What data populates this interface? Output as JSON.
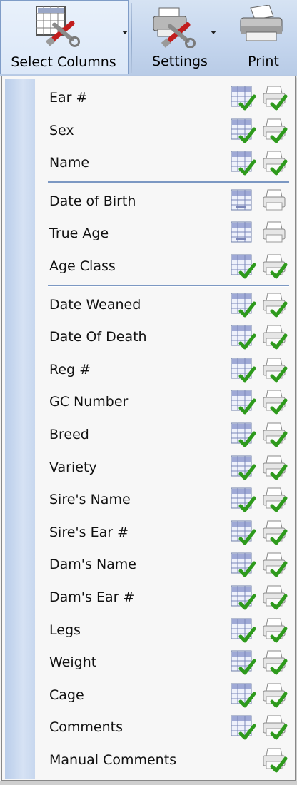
{
  "toolbar": {
    "select_columns_label": "Select Columns",
    "settings_label": "Settings",
    "print_label": "Print"
  },
  "menu": {
    "groups": [
      {
        "items": [
          {
            "label": "Ear #",
            "grid": "checked",
            "print": "checked"
          },
          {
            "label": "Sex",
            "grid": "checked",
            "print": "checked"
          },
          {
            "label": "Name",
            "grid": "checked",
            "print": "checked"
          }
        ]
      },
      {
        "items": [
          {
            "label": "Date of Birth",
            "grid": "hidden",
            "print": "unchecked"
          },
          {
            "label": "True Age",
            "grid": "hidden",
            "print": "unchecked"
          },
          {
            "label": "Age Class",
            "grid": "checked",
            "print": "checked"
          }
        ]
      },
      {
        "items": [
          {
            "label": "Date Weaned",
            "grid": "checked",
            "print": "checked"
          },
          {
            "label": "Date Of Death",
            "grid": "checked",
            "print": "checked"
          },
          {
            "label": "Reg #",
            "grid": "checked",
            "print": "checked"
          },
          {
            "label": "GC Number",
            "grid": "checked",
            "print": "checked"
          },
          {
            "label": "Breed",
            "grid": "checked",
            "print": "checked"
          },
          {
            "label": "Variety",
            "grid": "checked",
            "print": "checked"
          },
          {
            "label": "Sire's Name",
            "grid": "checked",
            "print": "checked"
          },
          {
            "label": "Sire's Ear #",
            "grid": "checked",
            "print": "checked"
          },
          {
            "label": "Dam's Name",
            "grid": "checked",
            "print": "checked"
          },
          {
            "label": "Dam's Ear #",
            "grid": "checked",
            "print": "checked"
          },
          {
            "label": "Legs",
            "grid": "checked",
            "print": "checked"
          },
          {
            "label": "Weight",
            "grid": "checked",
            "print": "checked"
          },
          {
            "label": "Cage",
            "grid": "checked",
            "print": "checked"
          },
          {
            "label": "Comments",
            "grid": "checked",
            "print": "checked"
          },
          {
            "label": "Manual Comments",
            "grid": "none",
            "print": "checked"
          }
        ]
      }
    ]
  },
  "icons": {
    "select_columns": "grid-wrench-icon",
    "settings": "printer-wrench-icon",
    "print": "printer-icon",
    "grid_column": "grid-column-icon",
    "print_column": "print-column-icon",
    "check": "green-check-icon",
    "hidden_marker": "not-shown-marker-icon"
  },
  "colors": {
    "ribbon_top": "#d6e3f3",
    "ribbon_bottom": "#b8cbe6",
    "menu_bg": "#f7f7f7",
    "gutter": "#c7d7ee",
    "divider": "#7c98c3",
    "check_green": "#2e9a1c"
  }
}
